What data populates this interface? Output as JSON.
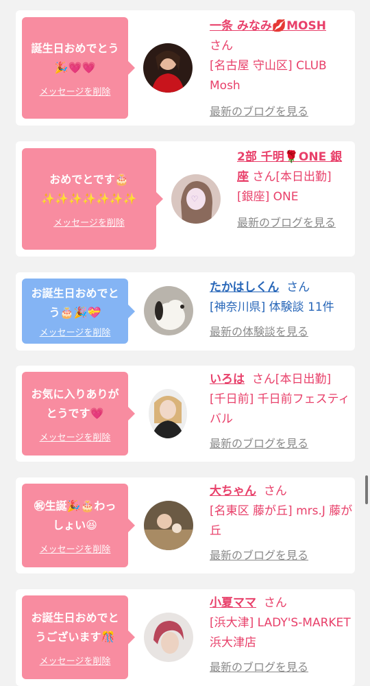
{
  "cards": [
    {
      "message_lines": [
        "誕生日おめでとう",
        "🎉💗💗"
      ],
      "delete_label": "メッセージを削除",
      "name": "一条 みなみ💋MOSH",
      "san": "さん",
      "shop": "[名古屋 守山区] CLUB Mosh",
      "link": "最新のブログを見る"
    },
    {
      "message_lines": [
        "おめでとです🎂",
        "✨✨✨✨✨✨✨"
      ],
      "delete_label": "メッセージを削除",
      "name": "2部 千明🌹ONE 銀座",
      "san": "さん[本日出勤]",
      "shop": "[銀座] ONE",
      "link": "最新のブログを見る"
    },
    {
      "message_lines": [
        "お誕生日おめでと",
        "う🎂🎉💝"
      ],
      "delete_label": "メッセージを削除",
      "name": "たかはしくん",
      "san": "さん",
      "shop": "[神奈川県] 体験談 11件",
      "link": "最新の体験談を見る"
    },
    {
      "message_lines": [
        "お気に入りありが",
        "とうです💗"
      ],
      "delete_label": "メッセージを削除",
      "name": "いろは",
      "san": "さん[本日出勤]",
      "shop": "[千日前] 千日前フェスティバル",
      "link": "最新のブログを見る"
    },
    {
      "message_lines": [
        "㊗生誕🎉🎂わっ",
        "しょい😆"
      ],
      "delete_label": "メッセージを削除",
      "name": "大ちゃん",
      "san": "さん",
      "shop": "[名東区 藤が丘] mrs.J 藤が丘",
      "link": "最新のブログを見る"
    },
    {
      "message_lines": [
        "お誕生日おめでと",
        "うございます🎊"
      ],
      "delete_label": "メッセージを削除",
      "name": "小夏ママ",
      "san": "さん",
      "shop": "[浜大津] LADY'S-MARKET 浜大津店",
      "link": "最新のブログを見る"
    }
  ],
  "colors": {
    "pink_bubble": "#f88ca0",
    "blue_bubble": "#84b4f4",
    "pink_text": "#e8406a",
    "blue_text": "#2766b8",
    "link_gray": "#8a8a8a"
  }
}
